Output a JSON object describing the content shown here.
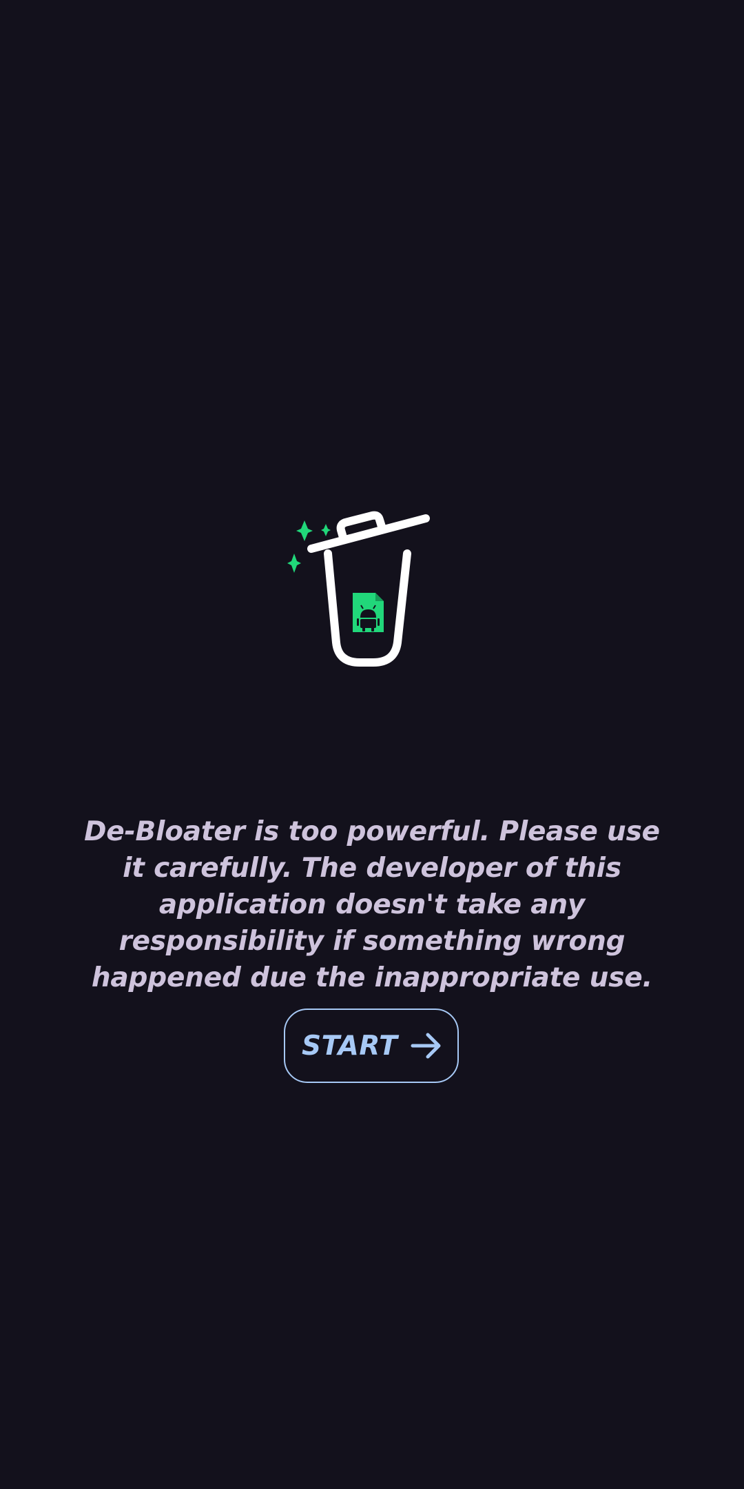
{
  "app": {
    "logo_icon": "trash-bin-android-icon"
  },
  "warning": {
    "text": "De-Bloater is too powerful. Please use it carefully. The developer of this application doesn't take any responsibility if something wrong happened due the inappropriate use."
  },
  "start": {
    "label": "START",
    "icon": "arrow-right-icon"
  },
  "colors": {
    "background": "#13111c",
    "text": "#cec3dc",
    "accent": "#a7c9f5",
    "green": "#21d77a",
    "white": "#ffffff"
  }
}
